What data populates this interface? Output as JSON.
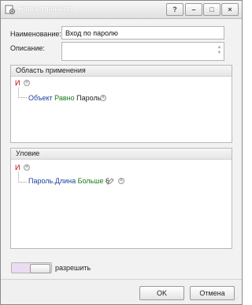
{
  "window": {
    "title": "Новое правило",
    "controls": {
      "help": "?",
      "minimize": "–",
      "maximize": "□",
      "close": "×"
    }
  },
  "form": {
    "name_label": "Наименование:",
    "name_value": "Вход по паролю",
    "description_label": "Описание:",
    "description_value": ""
  },
  "scope": {
    "header": "Область применения",
    "operator": "И",
    "condition": {
      "field": "Объект",
      "op": "Равно",
      "value": "Пароль"
    }
  },
  "condition_group": {
    "header": "Уловие",
    "operator": "И",
    "condition": {
      "field": "Пароль.Длина",
      "op": "Больше",
      "value": "6"
    }
  },
  "action": {
    "label": "разрешить"
  },
  "buttons": {
    "ok": "OK",
    "cancel": "Отмена"
  },
  "icons": {
    "app": "rule-gear-icon",
    "add": "add-circle-icon",
    "remove": "remove-circle-icon",
    "edit": "pencil-icon"
  }
}
